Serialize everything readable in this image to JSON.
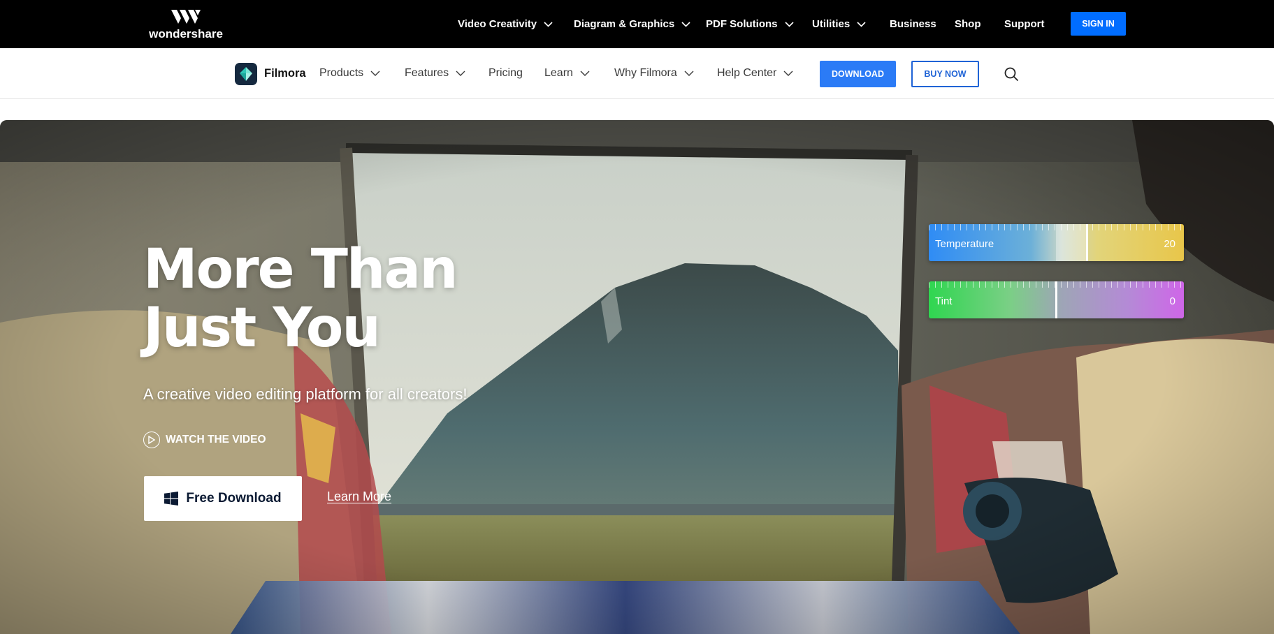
{
  "brand": {
    "name": "wondershare"
  },
  "topnav": {
    "items": [
      {
        "label": "Video Creativity",
        "dropdown": true
      },
      {
        "label": "Diagram & Graphics",
        "dropdown": true
      },
      {
        "label": "PDF Solutions",
        "dropdown": true
      },
      {
        "label": "Utilities",
        "dropdown": true
      },
      {
        "label": "Business",
        "dropdown": false
      },
      {
        "label": "Shop",
        "dropdown": false
      },
      {
        "label": "Support",
        "dropdown": false
      }
    ],
    "signin_label": "SIGN IN"
  },
  "subnav": {
    "product_name": "Filmora",
    "items": [
      {
        "label": "Products",
        "dropdown": true
      },
      {
        "label": "Features",
        "dropdown": true
      },
      {
        "label": "Pricing",
        "dropdown": false
      },
      {
        "label": "Learn",
        "dropdown": true
      },
      {
        "label": "Why Filmora",
        "dropdown": true
      },
      {
        "label": "Help Center",
        "dropdown": true
      }
    ],
    "download_label": "DOWNLOAD",
    "buy_label": "BUY NOW",
    "search_icon": "search-icon"
  },
  "hero": {
    "title_line1": "More Than",
    "title_line2": "Just You",
    "subtitle": "A creative video editing platform for all creators!",
    "watch_label": "WATCH THE VIDEO",
    "free_download_label": "Free Download",
    "learn_more_label": "Learn More",
    "sliders": {
      "temperature": {
        "label": "Temperature",
        "value": "20"
      },
      "tint": {
        "label": "Tint",
        "value": "0"
      }
    }
  },
  "colors": {
    "topbar_bg": "#000000",
    "accent_blue": "#006dff",
    "download_blue": "#2b7bf6",
    "buy_outline": "#1f63d6"
  }
}
